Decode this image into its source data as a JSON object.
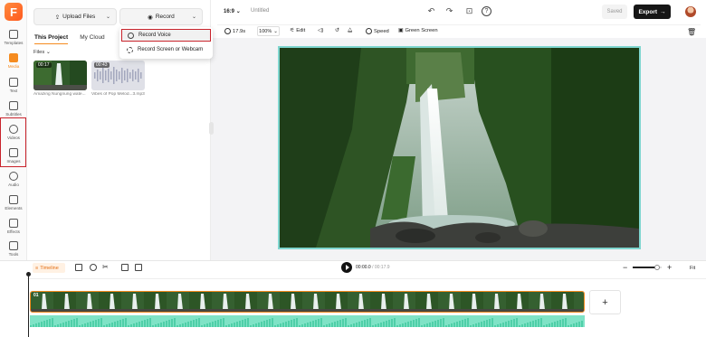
{
  "sidebar": {
    "logo": "F",
    "items": [
      {
        "label": "Templates"
      },
      {
        "label": "Media"
      },
      {
        "label": "Text"
      },
      {
        "label": "Subtitles"
      },
      {
        "label": "Videos"
      },
      {
        "label": "Images"
      },
      {
        "label": "Audio"
      },
      {
        "label": "Elements"
      },
      {
        "label": "Effects"
      },
      {
        "label": "Tools"
      }
    ]
  },
  "panel": {
    "upload_label": "Upload Files",
    "record_label": "Record",
    "tabs": [
      "This Project",
      "My Cloud"
    ],
    "files_label": "Files",
    "media": [
      {
        "duration": "00:17",
        "name": "Amazing Nungnung wate..."
      },
      {
        "duration": "00:43",
        "name": "Vibes of Pop Melod...3.mp3"
      }
    ]
  },
  "record_menu": {
    "items": [
      "Record Voice",
      "Record Screen or Webcam"
    ]
  },
  "topbar": {
    "aspect": "16:9",
    "title": "Untitled",
    "saved_label": "Saved",
    "export_label": "Export"
  },
  "edit_toolbar": {
    "duration": "17.9s",
    "zoom": "100%",
    "edit_label": "Edit",
    "speed_label": "Speed",
    "greenscreen_label": "Green Screen"
  },
  "timeline": {
    "timeline_label": "Timeline",
    "current_time": "00:00.0",
    "total_time": " / 00:17.9",
    "fit_label": "Fit",
    "zoom_fraction": 0.85,
    "clip_label": "01",
    "add_label": "+"
  },
  "colors": {
    "accent": "#f58b1f",
    "highlight": "#c8232c",
    "audio": "#7fe3c6"
  }
}
